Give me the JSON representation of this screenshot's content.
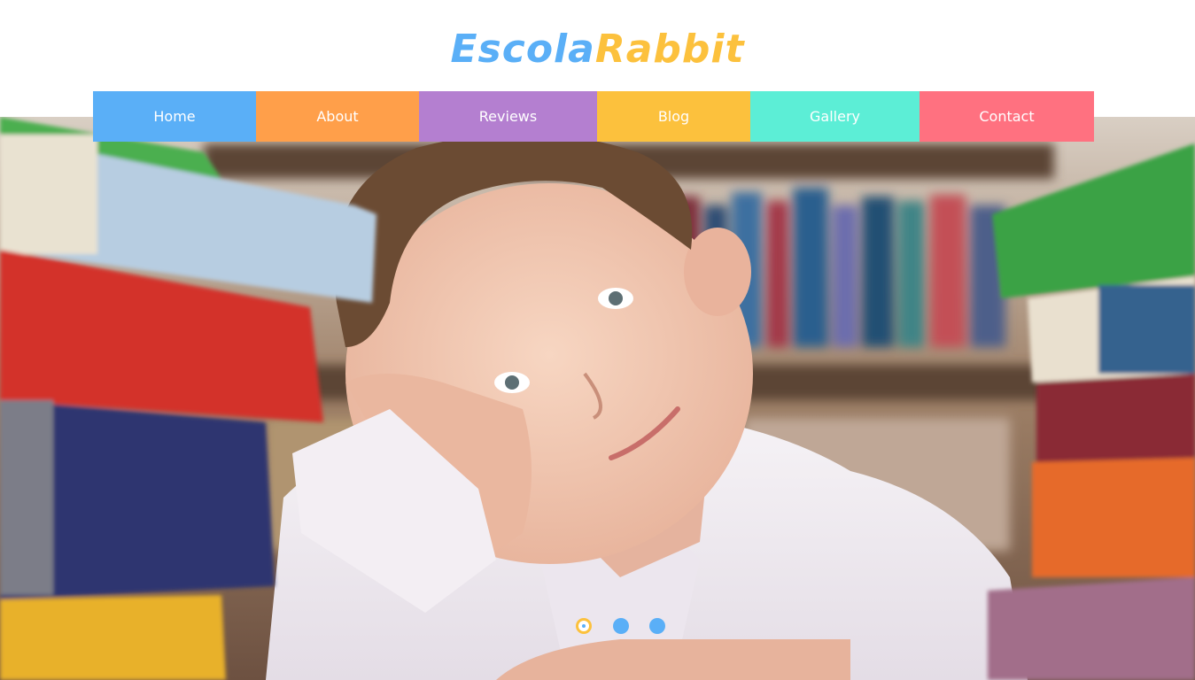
{
  "brand": {
    "part1": "Escola",
    "part2": "Rabbit",
    "color1": "#5aaff7",
    "color2": "#fcc13d"
  },
  "nav": {
    "items": [
      {
        "label": "Home",
        "color": "#5aaff7"
      },
      {
        "label": "About",
        "color": "#ff9f4a"
      },
      {
        "label": "Reviews",
        "color": "#b47fd0"
      },
      {
        "label": "Blog",
        "color": "#fcc13d"
      },
      {
        "label": "Gallery",
        "color": "#5ceed6"
      },
      {
        "label": "Contact",
        "color": "#ff7180"
      }
    ]
  },
  "slider": {
    "image": "boy-with-books-photo",
    "slide_count": 3,
    "active_slide": 1
  }
}
